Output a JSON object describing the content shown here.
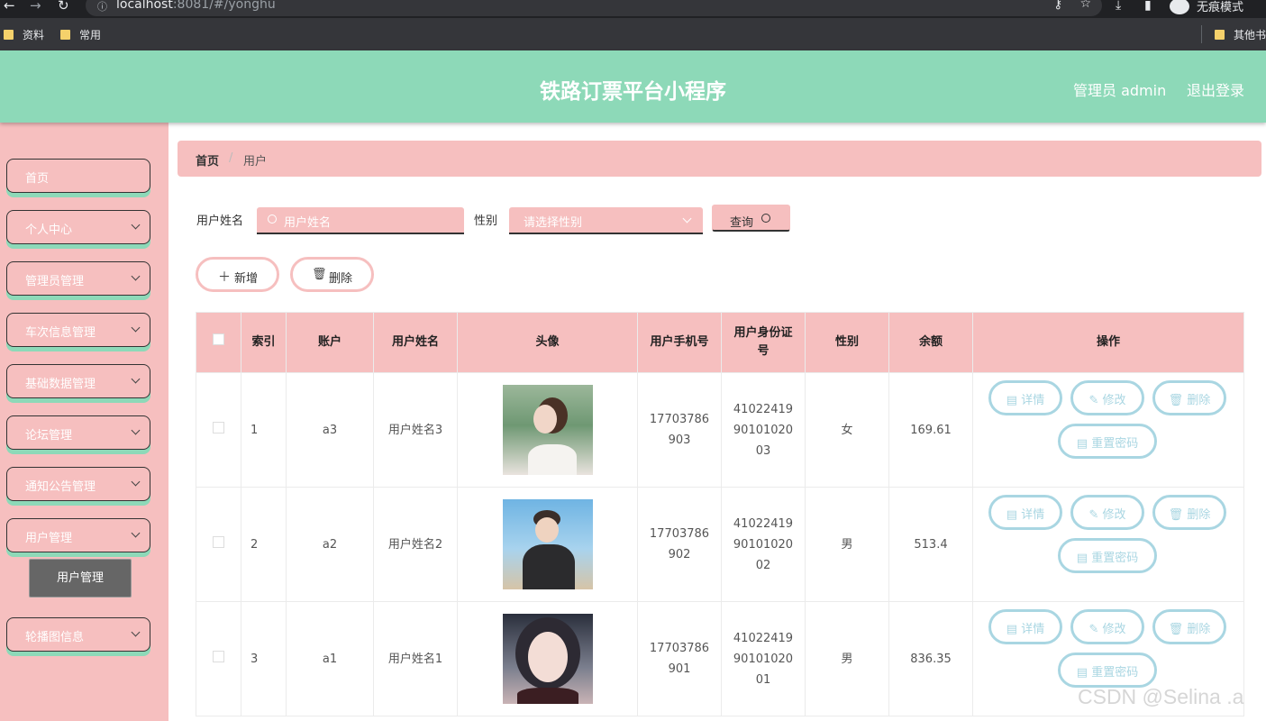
{
  "browser": {
    "url_host": "localhost",
    "url_rest": ":8081/#/yonghu",
    "incognito_label": "无痕模式",
    "bookmarks": [
      "资料",
      "常用",
      "其他书"
    ]
  },
  "header": {
    "title": "铁路订票平台小程序",
    "user": "管理员 admin",
    "logout": "退出登录"
  },
  "sidebar": {
    "items": [
      {
        "label": "首页",
        "has_chevron": false
      },
      {
        "label": "个人中心",
        "has_chevron": true
      },
      {
        "label": "管理员管理",
        "has_chevron": true
      },
      {
        "label": "车次信息管理",
        "has_chevron": true
      },
      {
        "label": "基础数据管理",
        "has_chevron": true
      },
      {
        "label": "论坛管理",
        "has_chevron": true
      },
      {
        "label": "通知公告管理",
        "has_chevron": true
      },
      {
        "label": "用户管理",
        "has_chevron": true
      },
      {
        "label": "轮播图信息",
        "has_chevron": true
      }
    ],
    "sub_active": "用户管理"
  },
  "breadcrumb": {
    "home": "首页",
    "separator": "/",
    "current": "用户"
  },
  "search": {
    "name_label": "用户姓名",
    "name_placeholder": "用户姓名",
    "gender_label": "性别",
    "gender_placeholder": "请选择性别",
    "query_label": "查询"
  },
  "actions": {
    "add_label": "新增",
    "delete_label": "删除"
  },
  "table": {
    "headers": [
      "",
      "索引",
      "账户",
      "用户姓名",
      "头像",
      "用户手机号",
      "用户身份证号",
      "性别",
      "余额",
      "操作"
    ],
    "rows": [
      {
        "index": "1",
        "account": "a3",
        "name": "用户姓名3",
        "phone": "17703786903",
        "id_card": "410224199010102003",
        "gender": "女",
        "balance": "169.61"
      },
      {
        "index": "2",
        "account": "a2",
        "name": "用户姓名2",
        "phone": "17703786902",
        "id_card": "410224199010102002",
        "gender": "男",
        "balance": "513.4"
      },
      {
        "index": "3",
        "account": "a1",
        "name": "用户姓名1",
        "phone": "17703786901",
        "id_card": "410224199010102001",
        "gender": "男",
        "balance": "836.35"
      }
    ],
    "op_labels": {
      "detail": "详情",
      "edit": "修改",
      "delete": "删除",
      "reset": "重置密码"
    }
  },
  "colors": {
    "header_green": "#8dd9b8",
    "pink": "#f6bfbf",
    "op_blue": "#a9d6e2"
  },
  "watermark": "CSDN @Selina .a"
}
